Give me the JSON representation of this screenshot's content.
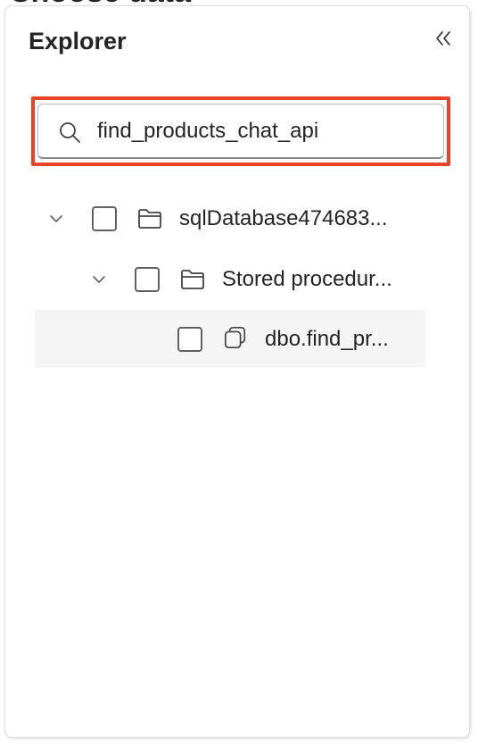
{
  "header": {
    "partial_heading": "Choose data"
  },
  "explorer": {
    "title": "Explorer",
    "collapse_icon": "double-chevron-left-icon",
    "search": {
      "value": "find_products_chat_api",
      "placeholder": "",
      "highlight_color": "#e8442a"
    },
    "tree": [
      {
        "label": "sqlDatabase474683...",
        "icon": "folder-icon",
        "expanded": true,
        "checked": false
      },
      {
        "label": "Stored procedur...",
        "icon": "folder-icon",
        "expanded": true,
        "checked": false
      },
      {
        "label": "dbo.find_pr...",
        "icon": "stored-procedure-icon",
        "checked": false,
        "selected": true
      }
    ]
  }
}
